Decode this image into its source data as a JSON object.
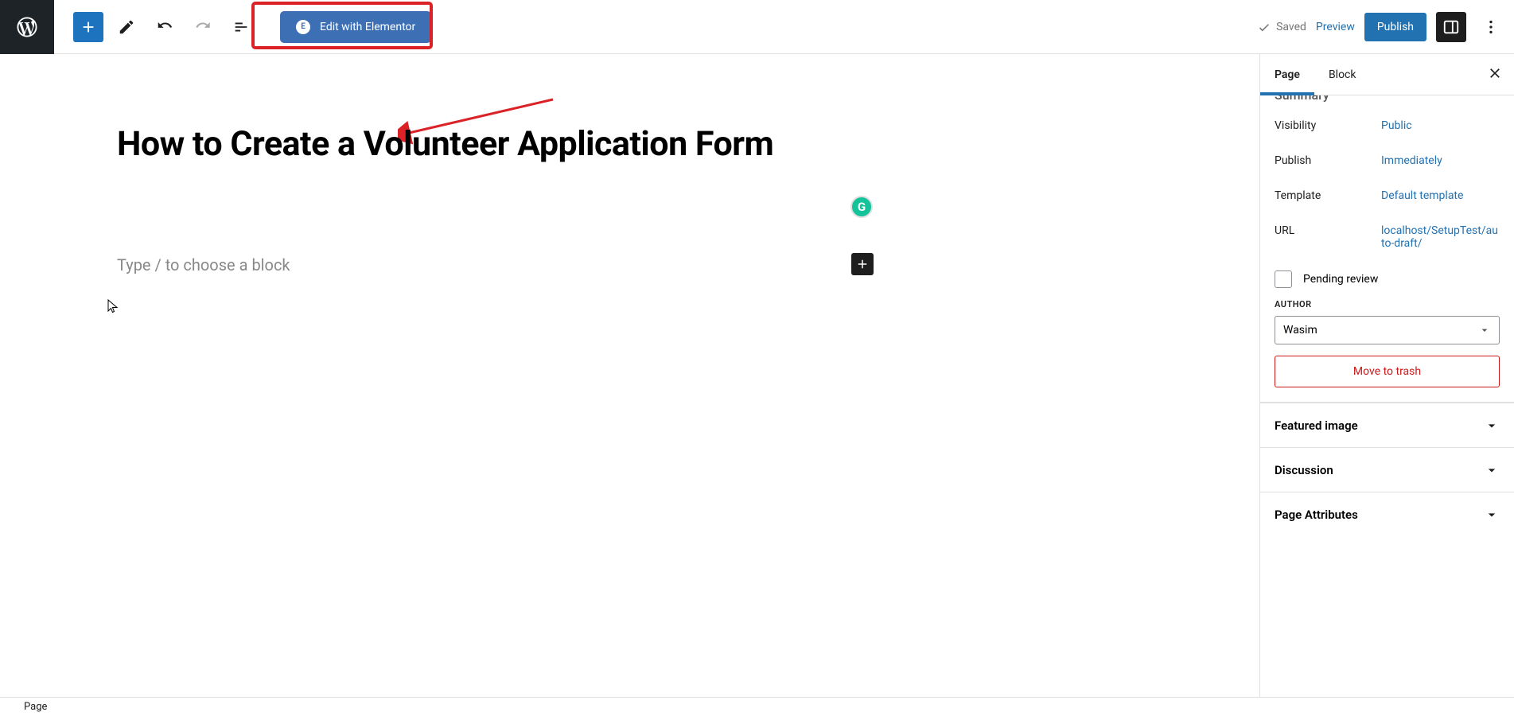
{
  "toolbar": {
    "elementor_label": "Edit with Elementor",
    "saved_label": "Saved",
    "preview_label": "Preview",
    "publish_label": "Publish"
  },
  "editor": {
    "title": "How to Create a Volunteer Application Form",
    "block_placeholder": "Type / to choose a block",
    "grammarly_letter": "G"
  },
  "sidebar": {
    "tabs": {
      "page": "Page",
      "block": "Block"
    },
    "summary_label": "Summary",
    "visibility": {
      "label": "Visibility",
      "value": "Public"
    },
    "publish": {
      "label": "Publish",
      "value": "Immediately"
    },
    "template": {
      "label": "Template",
      "value": "Default template"
    },
    "url": {
      "label": "URL",
      "value": "localhost/SetupTest/auto-draft/"
    },
    "pending_review": "Pending review",
    "author_label": "AUTHOR",
    "author_value": "Wasim",
    "trash": "Move to trash",
    "panels": {
      "featured": "Featured image",
      "discussion": "Discussion",
      "attributes": "Page Attributes"
    }
  },
  "footer": {
    "breadcrumb": "Page"
  }
}
